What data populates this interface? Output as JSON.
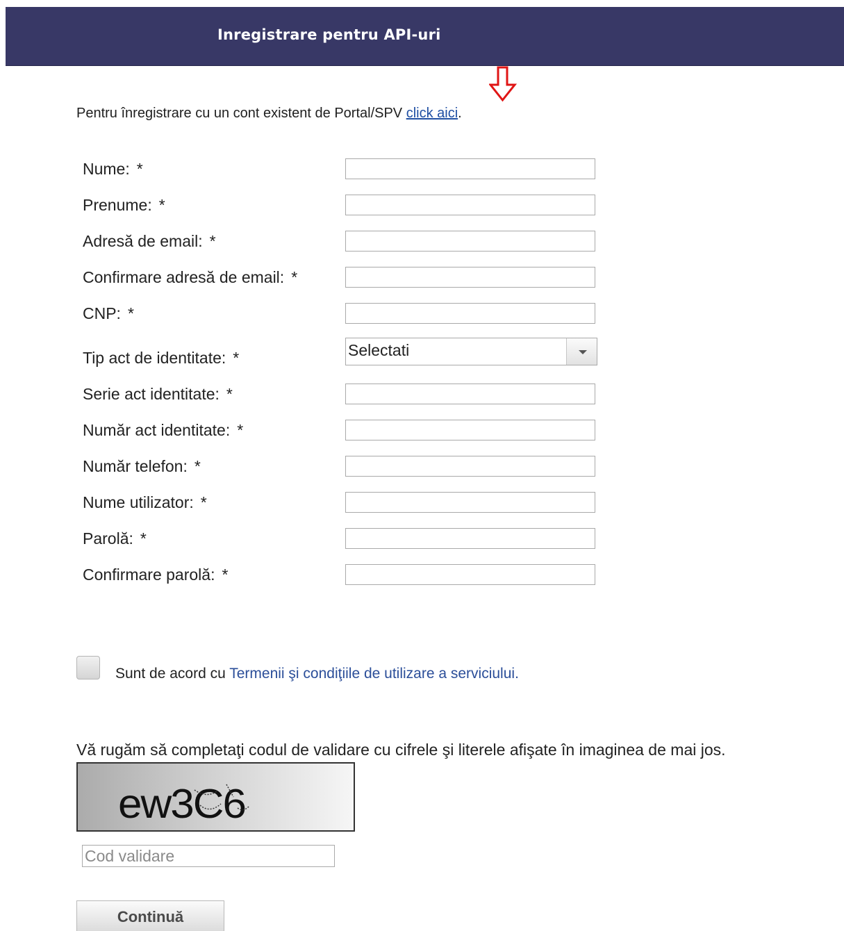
{
  "header": {
    "title": "Inregistrare pentru API-uri"
  },
  "intro": {
    "text": "Pentru înregistrare cu un cont existent de Portal/SPV ",
    "link": "click aici",
    "after": "."
  },
  "form": {
    "required_mark": "*",
    "fields": [
      {
        "label": "Nume:"
      },
      {
        "label": "Prenume:"
      },
      {
        "label": "Adresă de email:"
      },
      {
        "label": "Confirmare adresă de email:"
      },
      {
        "label": "CNP:"
      },
      {
        "label": "Tip act de identitate:",
        "selected": "Selectati"
      },
      {
        "label": "Serie act identitate:"
      },
      {
        "label": "Număr act identitate:"
      },
      {
        "label": "Număr telefon:"
      },
      {
        "label": "Nume utilizator:"
      },
      {
        "label": "Parolă:"
      },
      {
        "label": "Confirmare parolă:"
      }
    ]
  },
  "terms": {
    "prefix": "Sunt de acord cu ",
    "link": "Termenii şi condiţiile de utilizare a serviciului.",
    "checked": false
  },
  "captcha": {
    "instruction": "Vă rugăm să completaţi codul de validare cu cifrele şi literele afişate în imaginea de mai jos.",
    "code": "ew3C6",
    "input_placeholder": "Cod validare"
  },
  "submit": {
    "label": "Continuă"
  }
}
